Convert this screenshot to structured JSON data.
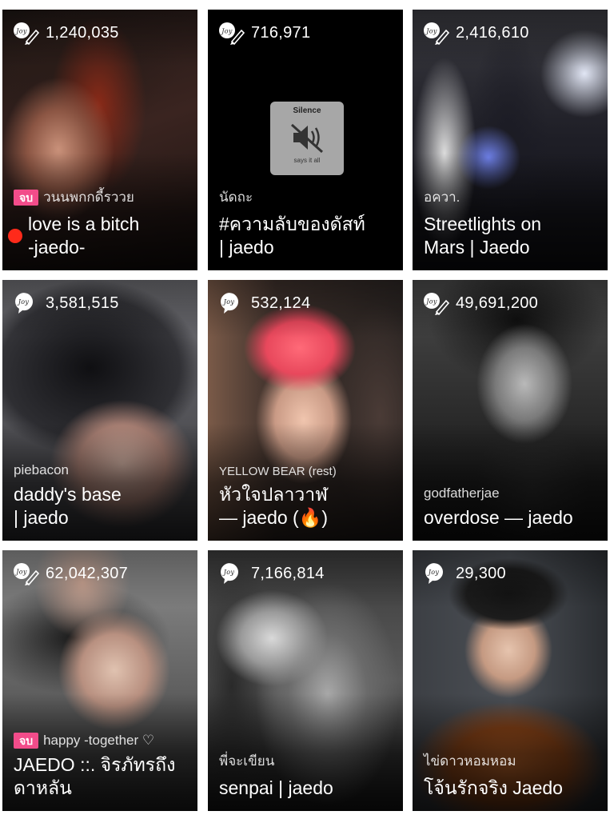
{
  "cards": [
    {
      "views": "1,240,035",
      "icon": "joy-pen-icon",
      "badge": "จบ",
      "author": "วนนพกกดี้รววย",
      "title_l1": "love is a bitch",
      "title_l2": "-jaedo-"
    },
    {
      "views": "716,971",
      "icon": "joy-pen-icon",
      "badge": "",
      "author": "นัดถะ",
      "title_l1": "#ความลับของดัสท์",
      "title_l2": "| jaedo",
      "silence_title": "Silence",
      "silence_sub": "says it all"
    },
    {
      "views": "2,416,610",
      "icon": "joy-pen-icon",
      "badge": "",
      "author": "อควา.",
      "title_l1": "Streetlights on",
      "title_l2": "Mars | Jaedo"
    },
    {
      "views": "3,581,515",
      "icon": "joy-icon",
      "badge": "",
      "author": "piebacon",
      "title_l1": "daddy's base",
      "title_l2": "| jaedo"
    },
    {
      "views": "532,124",
      "icon": "joy-icon",
      "badge": "",
      "author": "YELLOW BEAR (rest)",
      "title_l1": " หัวใจปลาวาฬ",
      "title_l2": "— jaedo (🔥)"
    },
    {
      "views": "49,691,200",
      "icon": "joy-pen-icon",
      "badge": "",
      "author": "godfatherjae",
      "title_l1": "overdose — jaedo",
      "title_l2": ""
    },
    {
      "views": "62,042,307",
      "icon": "joy-pen-icon",
      "badge": "จบ",
      "author": "happy -together ♡",
      "title_l1": "JAEDO ::. จิรภัทรถึง",
      "title_l2": "ดาหลัน"
    },
    {
      "views": "7,166,814",
      "icon": "joy-icon",
      "badge": "",
      "author": "พี่จะเขียน",
      "title_l1": "senpai | jaedo",
      "title_l2": ""
    },
    {
      "views": "29,300",
      "icon": "joy-icon",
      "badge": "",
      "author": "ไข่ดาวหอมหอม",
      "title_l1": "โจ้นรักจริง Jaedo",
      "title_l2": ""
    }
  ]
}
